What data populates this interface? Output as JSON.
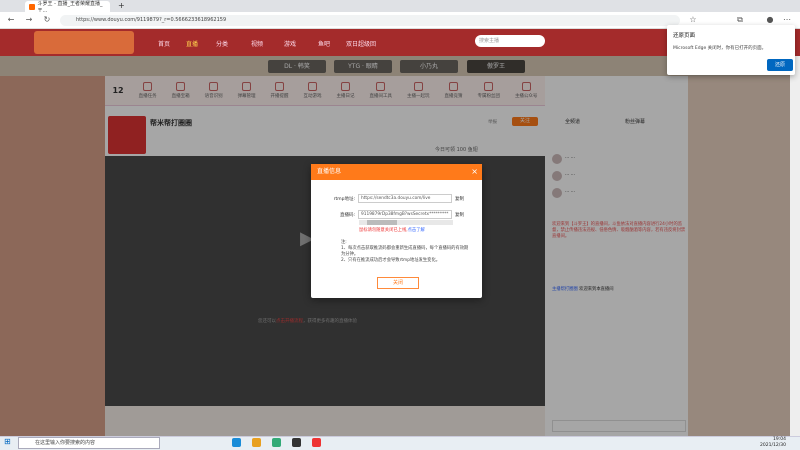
{
  "browser": {
    "tab_title": "斗罗王 - 直播_王者荣耀直播_王...",
    "url": "https://www.douyu.com/9119879?_r=0.5666233618962159",
    "new_tab": "+"
  },
  "site_nav": {
    "items": [
      "首页",
      "直播",
      "分类",
      "视频",
      "游戏",
      "鱼吧",
      "双日超级回"
    ],
    "search_placeholder": "搜索主播"
  },
  "categories": [
    "DL · 韩笑",
    "YTG · 眼睛",
    "小乃丸",
    "傲罗王"
  ],
  "stream_tools": {
    "level": "12",
    "items": [
      "直播任务",
      "直播宝箱",
      "语音识别",
      "弹幕管理",
      "开播提醒",
      "互动游戏",
      "主播日记",
      "直播间工具",
      "主播一起玩",
      "直播竞猜",
      "专属粉丝团",
      "主播公众号"
    ]
  },
  "streamer": {
    "name": "帮米帮打圈圈",
    "room_label": "举报",
    "follow": "关注",
    "stats": "今日可领 100 鱼翅"
  },
  "video": {
    "prompt": "您还可以",
    "link": "点击开播流程",
    "prompt_tail": "，获得更多有趣的直播体验"
  },
  "dialog": {
    "title": "直播信息",
    "close_x": "×",
    "rtmp_label": "rtmp地址:",
    "rtmp_value": "https://sendtc3a.douyu.com/live",
    "code_label": "直播码:",
    "code_value": "9119879rDp38fmgB?wsSecretx*********",
    "copy": "复制",
    "notice": "鼠标请勿随意关闭已上线,",
    "notice_link": "点击了解",
    "notes_title": "注:",
    "notes": [
      "1、每次点击获取推流码都会重新生成直播码，每个直播码的有效期为分钟。",
      "2、只有在推流成功后才会导致rtmp地址发生变化。"
    ],
    "close_button": "关闭"
  },
  "chat": {
    "tabs": [
      "全频道",
      "粉丝弹幕"
    ],
    "welcome": "欢迎来到【斗罗王】的直播间，斗鱼依法对直播内容进行24小时的监督，禁止传播违法违规、低俗色情、吸烟酗酒等内容，若有违反将封禁直播间。",
    "items": [
      {
        "user": "主播帮打圈圈",
        "text": "欢迎来到本直播间"
      },
      {
        "user": "斗罗王",
        "text": ""
      }
    ]
  },
  "edge_popup": {
    "title": "还原页面",
    "message": "Microsoft Edge 关闭时，你有已打开的页面。",
    "button": "还原"
  },
  "taskbar": {
    "search": "在这里输入你要搜索的内容",
    "time": "19:04",
    "date": "2021/12/30"
  }
}
